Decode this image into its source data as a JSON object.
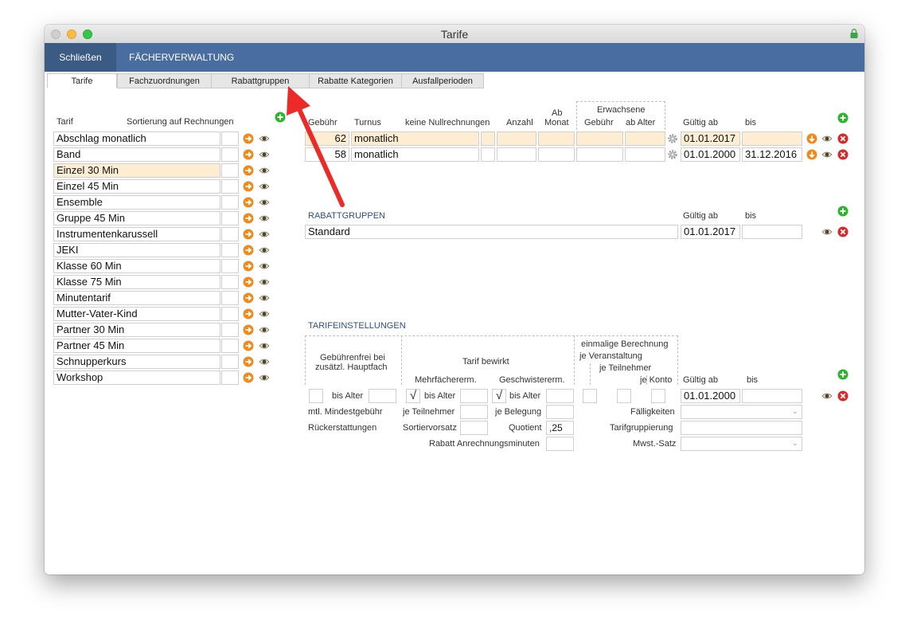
{
  "window": {
    "title": "Tarife"
  },
  "toolbar": {
    "close_label": "Schließen",
    "faecher_label": "FÄCHERVERWALTUNG"
  },
  "tabs": [
    "Tarife",
    "Fachzuordnungen",
    "Rabattgruppen",
    "Rabatte Kategorien",
    "Ausfallperioden"
  ],
  "left": {
    "col_tarif": "Tarif",
    "col_sort": "Sortierung auf Rechnungen",
    "tarife": [
      "Abschlag monatlich",
      "Band",
      "Einzel 30 Min",
      "Einzel 45 Min",
      "Ensemble",
      "Gruppe 45 Min",
      "Instrumentenkarussell",
      "JEKI",
      "Klasse 60 Min",
      "Klasse 75 Min",
      "Minutentarif",
      "Mutter-Vater-Kind",
      "Partner 30 Min",
      "Partner 45 Min",
      "Schnupperkurs",
      "Workshop"
    ],
    "selected": "Einzel 30 Min"
  },
  "fees": {
    "h_gebuehr": "Gebühr",
    "h_turnus": "Turnus",
    "h_keine": "keine Nullrechnungen",
    "h_anzahl": "Anzahl",
    "h_ab_monat_1": "Ab",
    "h_ab_monat_2": "Monat",
    "h_erwachsene": "Erwachsene",
    "h_erw_gebuehr": "Gebühr",
    "h_ab_alter": "ab Alter",
    "h_gueltig_ab": "Gültig ab",
    "h_bis": "bis",
    "rows": [
      {
        "gebuehr": "62",
        "turnus": "monatlich",
        "gueltig_ab": "01.01.2017",
        "bis": ""
      },
      {
        "gebuehr": "58",
        "turnus": "monatlich",
        "gueltig_ab": "01.01.2000",
        "bis": "31.12.2016"
      }
    ]
  },
  "rabattgruppen": {
    "title": "RABATTGRUPPEN",
    "h_gueltig_ab": "Gültig ab",
    "h_bis": "bis",
    "name": "Standard",
    "gueltig_ab": "01.01.2017",
    "bis": ""
  },
  "settings": {
    "title": "TARIFEINSTELLUNGEN",
    "gebuehrenfrei_1": "Gebührenfrei bei",
    "gebuehrenfrei_2": "zusätzl. Hauptfach",
    "tarif_bewirkt": "Tarif bewirkt",
    "mehrfach": "Mehrfächererm.",
    "geschwister": "Geschwistererm.",
    "einmalig_1": "einmalige Berechnung",
    "einmalig_2": "je Veranstaltung",
    "einmalig_3": "je Teilnehmer",
    "je_konto": "je Konto",
    "gueltig_ab_label": "Gültig ab",
    "bis_label": "bis",
    "bis_alter": "bis Alter",
    "gueltig_ab": "01.01.2000",
    "mindest": "mtl. Mindestgebühr",
    "je_teilnehmer": "je Teilnehmer",
    "je_belegung": "je Belegung",
    "faelligkeiten": "Fälligkeiten",
    "rueck": "Rückerstattungen",
    "sortiervorsatz": "Sortiervorsatz",
    "quotient": "Quotient",
    "quotient_value": ",25",
    "tarifgruppierung": "Tarifgruppierung",
    "rabatt_minuten": "Rabatt Anrechnungsminuten",
    "mwst": "Mwst.-Satz",
    "check_mark": "√"
  },
  "colors": {
    "blue_bar": "#486d9e",
    "highlight": "#fdedd2",
    "accent_orange": "#f08a1c",
    "add_green": "#2bb52b",
    "delete_red": "#d8282a",
    "annotation_red": "#ec2a28"
  }
}
